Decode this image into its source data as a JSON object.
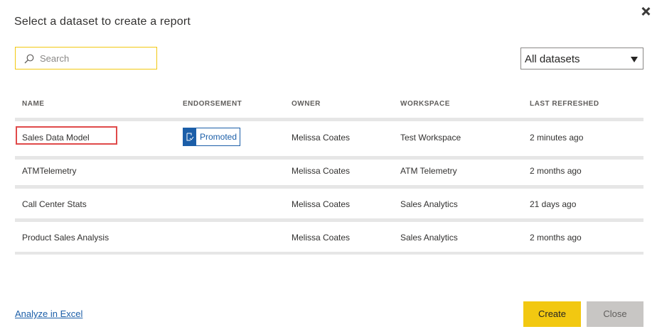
{
  "dialog": {
    "title": "Select a dataset to create a report"
  },
  "search": {
    "placeholder": "Search",
    "value": ""
  },
  "filter": {
    "selected": "All datasets"
  },
  "table": {
    "columns": [
      "NAME",
      "ENDORSEMENT",
      "OWNER",
      "WORKSPACE",
      "LAST REFRESHED"
    ],
    "rows": [
      {
        "name": "Sales Data Model",
        "endorsement": "Promoted",
        "owner": "Melissa Coates",
        "workspace": "Test Workspace",
        "last_refreshed": "2 minutes ago",
        "selected": true
      },
      {
        "name": "ATMTelemetry",
        "endorsement": "",
        "owner": "Melissa Coates",
        "workspace": "ATM Telemetry",
        "last_refreshed": "2 months ago",
        "selected": false
      },
      {
        "name": "Call Center Stats",
        "endorsement": "",
        "owner": "Melissa Coates",
        "workspace": "Sales Analytics",
        "last_refreshed": "21 days ago",
        "selected": false
      },
      {
        "name": "Product Sales Analysis",
        "endorsement": "",
        "owner": "Melissa Coates",
        "workspace": "Sales Analytics",
        "last_refreshed": "2 months ago",
        "selected": false
      }
    ]
  },
  "footer": {
    "analyze_link": "Analyze in Excel",
    "create_label": "Create",
    "close_label": "Close"
  },
  "colors": {
    "accent_yellow": "#f2c811",
    "link_blue": "#1b5ea8",
    "selection_red": "#e04a4a",
    "disabled_gray": "#c8c6c4"
  },
  "icons": {
    "close": "close-icon",
    "search": "search-icon",
    "dropdown": "chevron-down-icon",
    "endorsement": "promoted-icon"
  }
}
